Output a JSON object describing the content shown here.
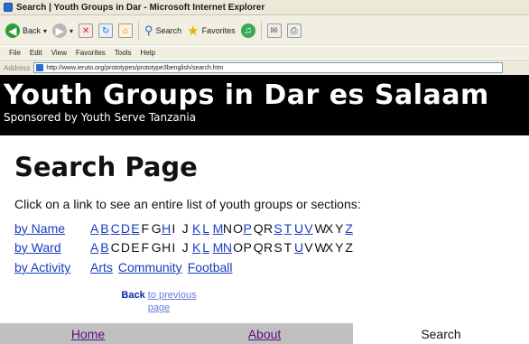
{
  "window": {
    "title": "Search | Youth Groups in Dar - Microsoft Internet Explorer"
  },
  "toolbar": {
    "back_label": "Back",
    "search_label": "Search",
    "favorites_label": "Favorites"
  },
  "menu": [
    "File",
    "Edit",
    "View",
    "Favorites",
    "Tools",
    "Help"
  ],
  "address": {
    "label": "Address",
    "url": "http://www.ieruto.org/prototypes/prototype3benglish/search.htm"
  },
  "banner": {
    "title": "Youth Groups in Dar es Salaam",
    "subtitle": "Sponsored by Youth Serve Tanzania"
  },
  "main": {
    "page_title": "Search Page",
    "intro": "Click on a link to see an entire list of youth groups or sections:",
    "rows": [
      {
        "label": "by Name",
        "letters": [
          "A",
          "B",
          "C",
          "D",
          "E",
          "F",
          "G",
          "H",
          "I",
          "J",
          "K",
          "L",
          "M",
          "N",
          "O",
          "P",
          "Q",
          "R",
          "S",
          "T",
          "U",
          "V",
          "W",
          "X",
          "Y",
          "Z"
        ],
        "linked": [
          true,
          true,
          true,
          true,
          true,
          false,
          false,
          true,
          false,
          false,
          true,
          true,
          true,
          false,
          false,
          true,
          false,
          false,
          true,
          true,
          true,
          true,
          false,
          false,
          false,
          true
        ]
      },
      {
        "label": "by Ward",
        "letters": [
          "A",
          "B",
          "C",
          "D",
          "E",
          "F",
          "G",
          "H",
          "I",
          "J",
          "K",
          "L",
          "M",
          "N",
          "O",
          "P",
          "Q",
          "R",
          "S",
          "T",
          "U",
          "V",
          "W",
          "X",
          "Y",
          "Z"
        ],
        "linked": [
          true,
          true,
          false,
          false,
          false,
          false,
          false,
          false,
          false,
          false,
          true,
          true,
          true,
          true,
          false,
          false,
          false,
          false,
          false,
          false,
          true,
          false,
          false,
          false,
          false,
          false
        ]
      },
      {
        "label": "by Activity",
        "activities": [
          "Arts",
          "Community",
          "Football"
        ]
      }
    ],
    "back_link": {
      "strong": "Back",
      "rest": "to previous page"
    }
  },
  "bottom_nav": {
    "home": "Home",
    "about": "About",
    "search": "Search"
  }
}
